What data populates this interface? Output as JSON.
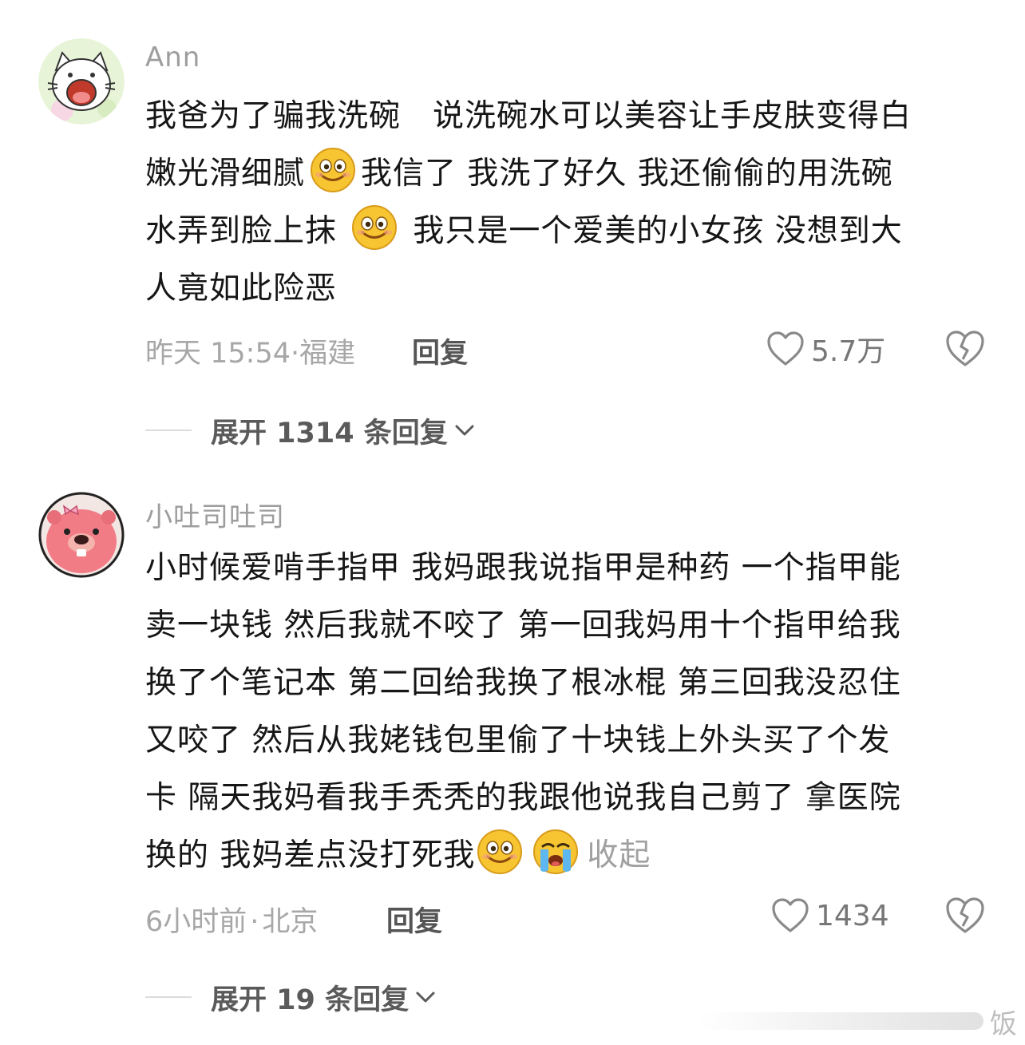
{
  "comments": [
    {
      "username": "Ann",
      "lines": [
        [
          "我爸为了骗我洗碗　说洗碗水可以美容让手皮肤变得白"
        ],
        [
          "嫩光滑细腻",
          "我信了 我洗了好久  我还偷偷的用洗碗"
        ],
        [
          "水弄到脸上抹",
          "  我只是一个爱美的小女孩 没想到大"
        ],
        [
          "人竟如此险恶"
        ]
      ],
      "emojis": [
        "smiling-face-emoji",
        "smiling-face-emoji"
      ],
      "time": "昨天 15:54",
      "location": "福建",
      "reply_label": "回复",
      "likes": "5.7万",
      "expand_label": "展开 1314 条回复"
    },
    {
      "username": "小吐司吐司",
      "lines": [
        [
          "小时候爱啃手指甲 我妈跟我说指甲是种药 一个指甲能"
        ],
        [
          "卖一块钱 然后我就不咬了 第一回我妈用十个指甲给我"
        ],
        [
          "换了个笔记本 第二回给我换了根冰棍 第三回我没忍住"
        ],
        [
          "又咬了 然后从我姥钱包里偷了十块钱上外头买了个发"
        ],
        [
          "卡 隔天我妈看我手秃秃的我跟他说我自己剪了 拿医院"
        ],
        [
          "换的 我妈差点没打死我"
        ]
      ],
      "emojis": [
        "smiling-face-emoji",
        "crying-face-emoji"
      ],
      "collapse_label": "收起",
      "time": "6小时前",
      "location": "北京",
      "reply_label": "回复",
      "likes": "1434",
      "expand_label": "展开 19 条回复"
    }
  ],
  "separator": "·",
  "watermark_text": "饭",
  "colors": {
    "text": "#161616",
    "meta": "#a7a7a7",
    "username": "#9d9d9d",
    "accent_emoji": "#f7c531"
  }
}
